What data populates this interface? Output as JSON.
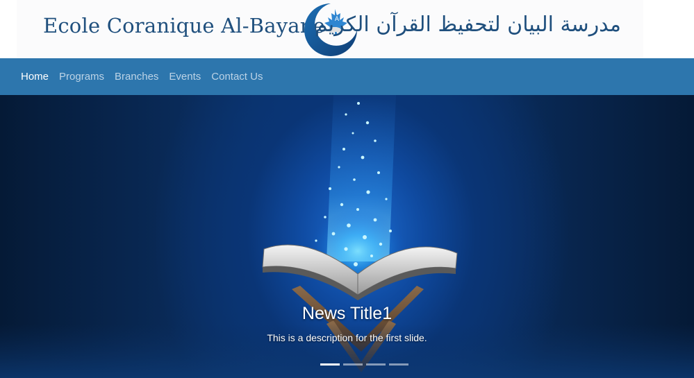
{
  "header": {
    "brand_latin": "Ecole Coranique Al-Bayane",
    "brand_arabic": "مدرسة البيان لتحفيظ القرآن الكريم",
    "logo_icon": "maple-leaf-crescent-logo",
    "brand_color": "#1f4f7d"
  },
  "nav": {
    "background": "#2d76ad",
    "items": [
      {
        "label": "Home",
        "active": true
      },
      {
        "label": "Programs",
        "active": false
      },
      {
        "label": "Branches",
        "active": false
      },
      {
        "label": "Events",
        "active": false
      },
      {
        "label": "Contact Us",
        "active": false
      }
    ]
  },
  "carousel": {
    "image": "glowing-quran-on-stand",
    "slide": {
      "title": "News Title1",
      "description": "This is a description for the first slide."
    },
    "indicator_count": 4,
    "active_index": 0
  }
}
